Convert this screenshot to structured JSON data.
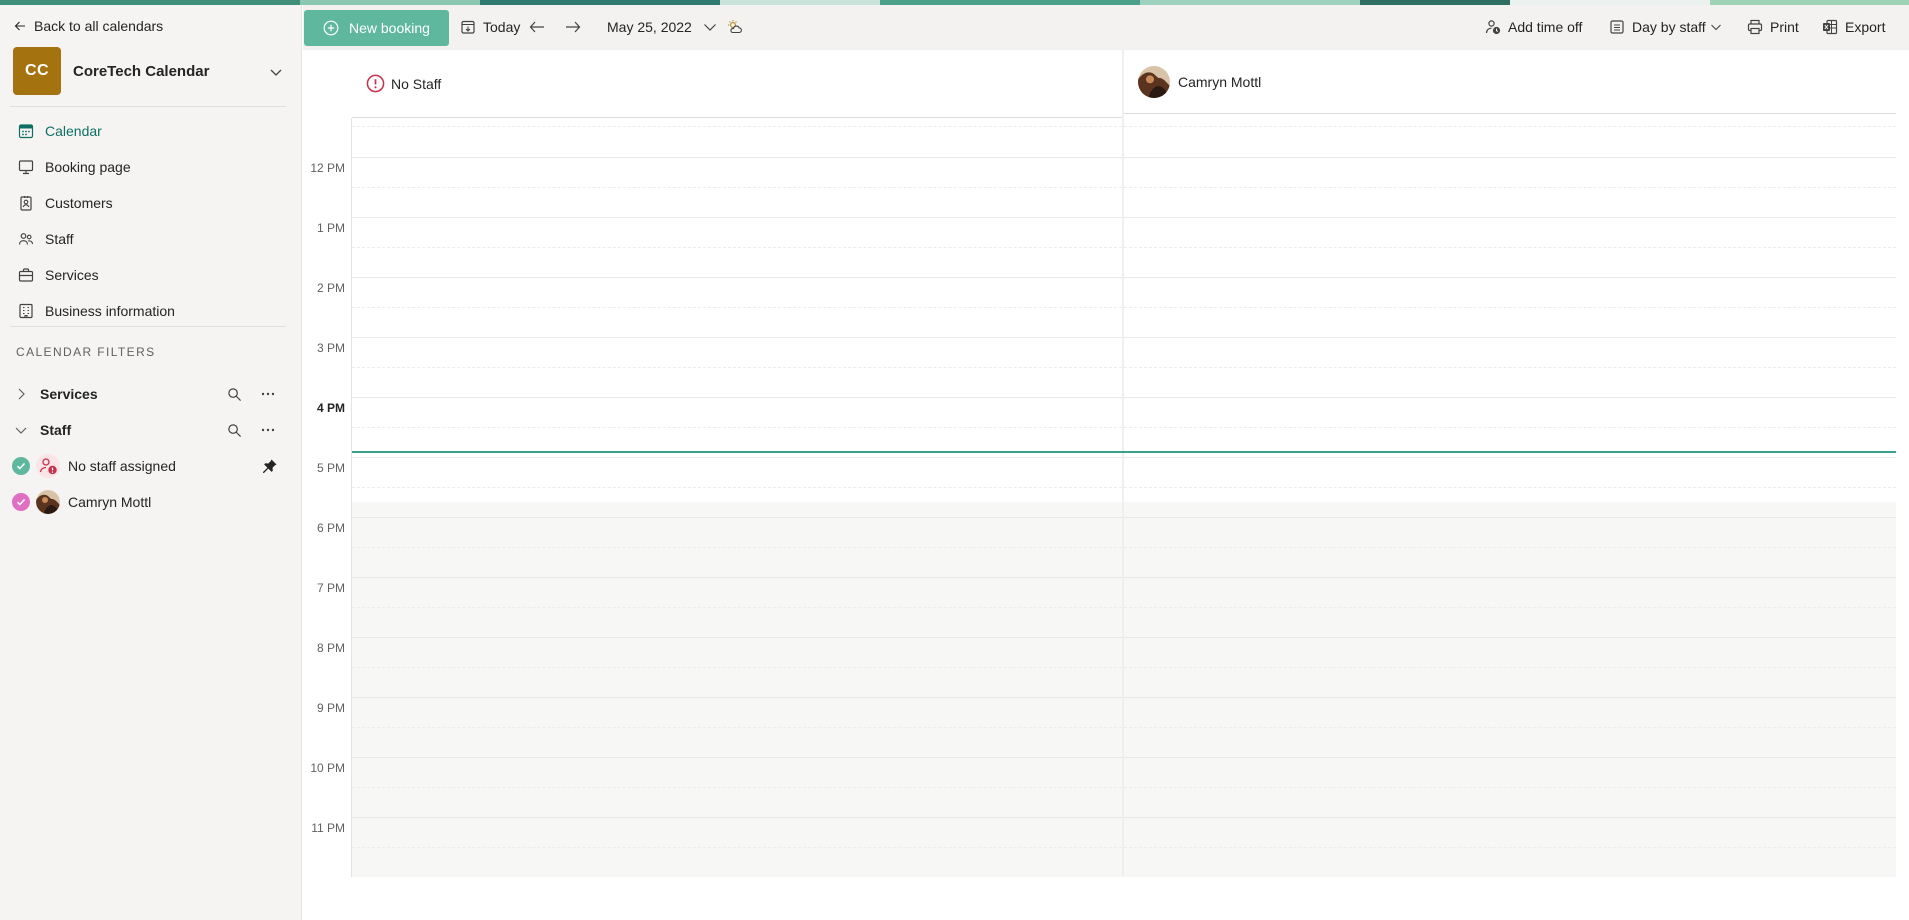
{
  "app": {
    "back_label": "Back to all calendars",
    "calendar_initials": "CC",
    "calendar_name": "CoreTech Calendar",
    "brand_color": "#a4730f",
    "accent_color": "#5fb89e"
  },
  "nav": {
    "items": [
      {
        "label": "Calendar",
        "icon": "calendar-icon",
        "active": true
      },
      {
        "label": "Booking page",
        "icon": "monitor-icon",
        "active": false
      },
      {
        "label": "Customers",
        "icon": "contact-card-icon",
        "active": false
      },
      {
        "label": "Staff",
        "icon": "people-icon",
        "active": false
      },
      {
        "label": "Services",
        "icon": "briefcase-icon",
        "active": false
      },
      {
        "label": "Business information",
        "icon": "building-icon",
        "active": false
      }
    ]
  },
  "filters": {
    "title": "CALENDAR FILTERS",
    "groups": [
      {
        "label": "Services",
        "expanded": false
      },
      {
        "label": "Staff",
        "expanded": true
      }
    ],
    "staff": [
      {
        "label": "No staff assigned",
        "check_color": "#5fb89e",
        "pinned": true
      },
      {
        "label": "Camryn Mottl",
        "check_color": "#e06fc4",
        "pinned": false
      }
    ]
  },
  "toolbar": {
    "new_booking": "New booking",
    "today": "Today",
    "date": "May 25, 2022",
    "add_time_off": "Add time off",
    "view": "Day by staff",
    "print": "Print",
    "export": "Export"
  },
  "calendar": {
    "columns": [
      {
        "label": "No Staff",
        "icon": "alert-circle-icon"
      },
      {
        "label": "Camryn Mottl",
        "icon": "avatar"
      }
    ],
    "hours": [
      "12 PM",
      "1 PM",
      "2 PM",
      "3 PM",
      "4 PM",
      "5 PM",
      "6 PM",
      "7 PM",
      "8 PM",
      "9 PM",
      "10 PM",
      "11 PM"
    ],
    "current_hour": "4 PM",
    "now_line_color": "#3a9f8b"
  }
}
